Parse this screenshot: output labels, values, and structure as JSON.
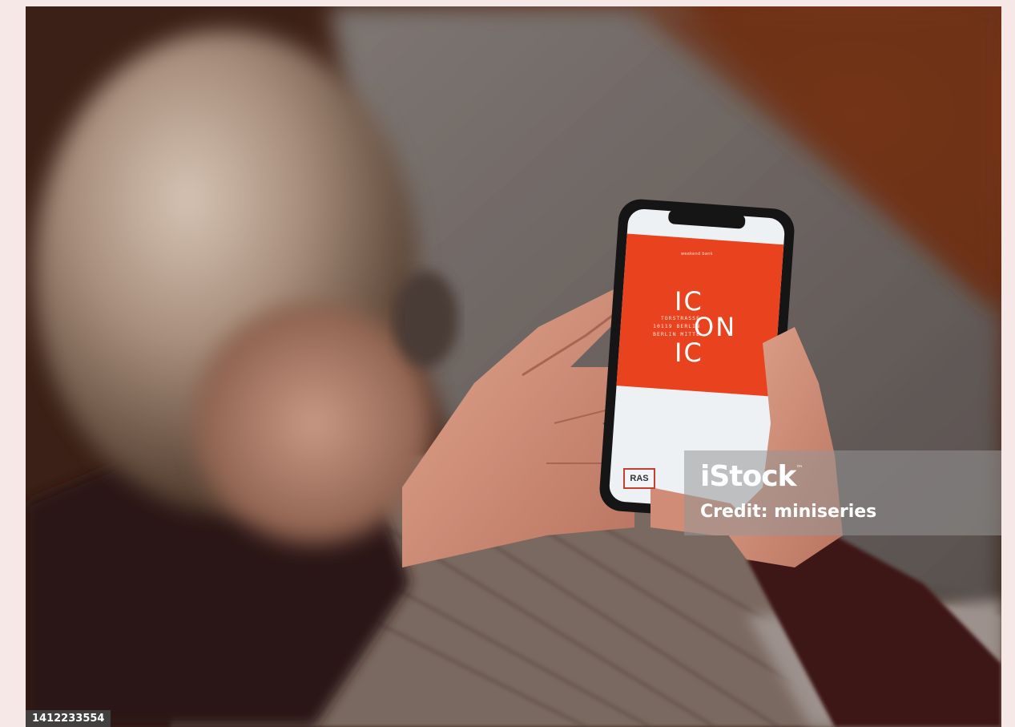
{
  "phone_screen": {
    "top_brand": "weekend bank",
    "address_lines": [
      "TORSTRASSE",
      "10119 BERLIN",
      "BERLIN MITTE"
    ],
    "logo_lines": [
      "IC",
      "ON",
      "IC"
    ],
    "badge": "RAS",
    "accent_color": "#e9421e"
  },
  "watermark": {
    "logo": "iStock",
    "trademark": "™",
    "credit": "Credit: miniseries"
  },
  "image_id": "1412233554"
}
